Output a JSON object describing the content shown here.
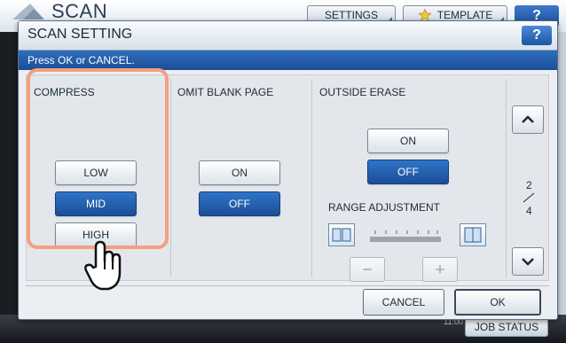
{
  "background": {
    "title": "SCAN",
    "settings_label": "SETTINGS",
    "template_label": "TEMPLATE",
    "help_label": "?",
    "time": "11:00",
    "job_status_label": "JOB STATUS"
  },
  "dialog": {
    "title": "SCAN SETTING",
    "help_label": "?",
    "instruction": "Press OK or CANCEL.",
    "compress": {
      "label": "COMPRESS",
      "options": [
        "LOW",
        "MID",
        "HIGH"
      ],
      "selected": "MID"
    },
    "omit_blank_page": {
      "label": "OMIT BLANK PAGE",
      "options": [
        "ON",
        "OFF"
      ],
      "selected": "OFF"
    },
    "outside_erase": {
      "label": "OUTSIDE ERASE",
      "options": [
        "ON",
        "OFF"
      ],
      "selected": "OFF",
      "range_adjustment_label": "RANGE ADJUSTMENT",
      "minus_label": "−",
      "plus_label": "+"
    },
    "pager": {
      "current": "2",
      "total": "4"
    },
    "cancel_label": "CANCEL",
    "ok_label": "OK"
  },
  "colors": {
    "selected_button": "#1b4f96",
    "instruction_bar": "#2f6dbd",
    "highlight_frame": "#f2a080"
  },
  "icons": [
    "star-icon",
    "help-icon",
    "book-icon",
    "chevron-up-icon",
    "chevron-down-icon",
    "hand-pointer-icon"
  ]
}
